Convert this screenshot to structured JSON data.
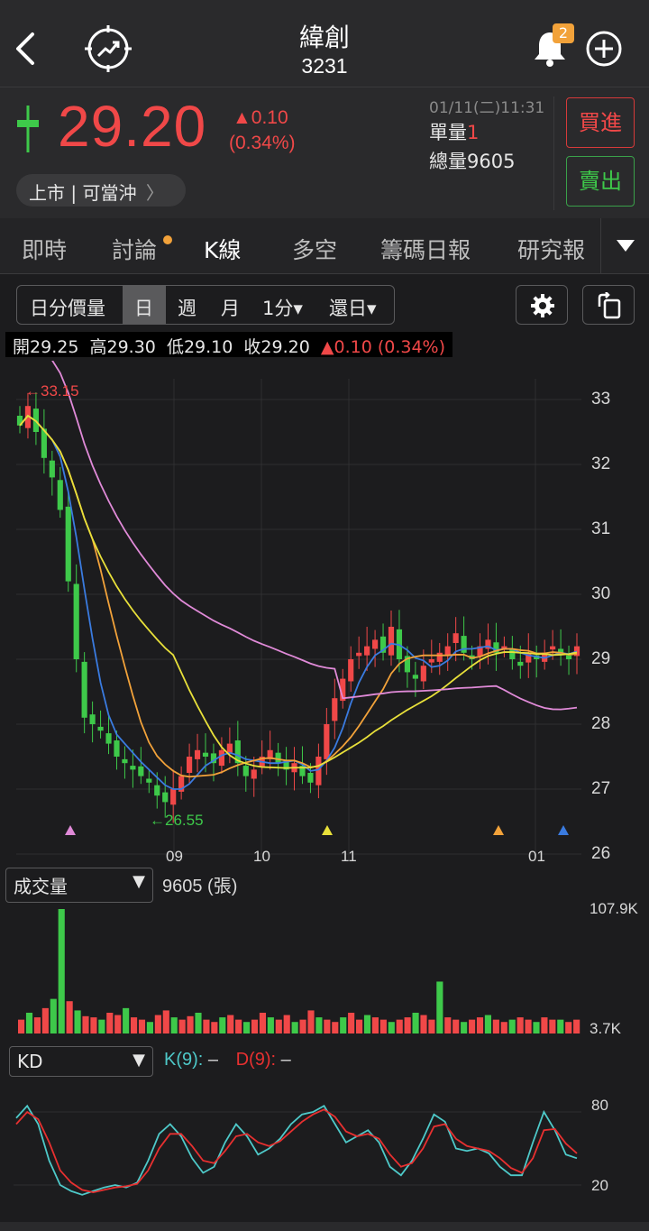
{
  "header": {
    "name": "緯創",
    "code": "3231",
    "notification_count": "2"
  },
  "quote": {
    "price": "29.20",
    "change": "▲0.10",
    "change_pct": "(0.34%)",
    "datetime": "01/11(二)11:31",
    "unit_label": "單量",
    "unit_value": "1",
    "total_label": "總量",
    "total_value": "9605",
    "market_pill": "上市 | 可當沖",
    "buy_label": "買進",
    "sell_label": "賣出"
  },
  "tabs": [
    "即時",
    "討論",
    "K線",
    "多空",
    "籌碼日報",
    "研究報"
  ],
  "active_tab": "K線",
  "toolbar": {
    "items": [
      "日分價量",
      "日",
      "週",
      "月",
      "1分▾",
      "還日▾"
    ],
    "active": "日"
  },
  "ohlc": {
    "open_label": "開",
    "open": "29.25",
    "high_label": "高",
    "high": "29.30",
    "low_label": "低",
    "low": "29.10",
    "close_label": "收",
    "close": "29.20",
    "change": "▲0.10 (0.34%)"
  },
  "price_chart": {
    "y_ticks": [
      "33",
      "32",
      "31",
      "30",
      "29",
      "28",
      "27",
      "26"
    ],
    "x_ticks": [
      "09",
      "10",
      "11",
      "01"
    ],
    "high_marker": "←33.15",
    "low_marker": "←26.55"
  },
  "volume_panel": {
    "selector": "成交量",
    "value": "9605 (張)",
    "y_ticks": [
      "107.9K",
      "3.7K"
    ]
  },
  "kd_panel": {
    "selector": "KD",
    "k_label": "K(9):",
    "k_value": "–",
    "d_label": "D(9):",
    "d_value": "–",
    "y_ticks": [
      "80",
      "20"
    ]
  },
  "colors": {
    "up": "#f04848",
    "down": "#3ec94a",
    "ma5": "#3a7be0",
    "ma10": "#f2a23a",
    "ma20": "#e8e03a",
    "ma60": "#e08ad8",
    "k_line": "#4ec9c9",
    "d_line": "#e83030"
  },
  "chart_data": {
    "type": "candlestick",
    "ylim": [
      26,
      33.3
    ],
    "close_series_approx": [
      32.6,
      32.9,
      32.5,
      32.1,
      31.8,
      31.3,
      30.2,
      29.0,
      28.1,
      28.0,
      27.9,
      27.7,
      27.5,
      27.4,
      27.3,
      27.2,
      27.1,
      26.9,
      26.8,
      27.0,
      27.2,
      27.5,
      27.6,
      27.5,
      27.4,
      27.6,
      27.7,
      27.4,
      27.2,
      27.3,
      27.5,
      27.6,
      27.4,
      27.3,
      27.4,
      27.2,
      27.1,
      27.5,
      28.0,
      28.4,
      28.7,
      29.0,
      29.1,
      29.2,
      29.3,
      29.1,
      29.5,
      29.0,
      28.8,
      28.7,
      28.9,
      29.0,
      29.1,
      29.2,
      29.4,
      29.1,
      29.0,
      29.2,
      29.3,
      29.1,
      29.2,
      29.0,
      28.9,
      29.1,
      29.0,
      29.1,
      29.2,
      29.1,
      29.0,
      29.2
    ],
    "volume_series_approx": [
      12,
      18,
      14,
      22,
      30,
      107.9,
      28,
      20,
      15,
      14,
      12,
      18,
      16,
      22,
      14,
      12,
      10,
      16,
      20,
      14,
      12,
      15,
      18,
      12,
      10,
      14,
      16,
      12,
      10,
      12,
      18,
      14,
      12,
      16,
      10,
      12,
      20,
      14,
      12,
      10,
      14,
      18,
      12,
      16,
      14,
      12,
      10,
      12,
      14,
      18,
      16,
      12,
      45,
      14,
      12,
      10,
      12,
      14,
      16,
      12,
      10,
      12,
      14,
      12,
      10,
      14,
      12,
      12,
      10,
      12
    ],
    "k_series_approx": [
      75,
      85,
      70,
      40,
      20,
      15,
      12,
      15,
      18,
      20,
      18,
      22,
      40,
      62,
      70,
      60,
      42,
      30,
      35,
      55,
      70,
      60,
      45,
      50,
      58,
      70,
      78,
      80,
      85,
      70,
      55,
      60,
      65,
      55,
      35,
      28,
      40,
      58,
      78,
      72,
      50,
      48,
      50,
      46,
      35,
      28,
      28,
      55,
      80,
      65,
      45,
      42
    ],
    "d_series_approx": [
      70,
      80,
      74,
      55,
      32,
      22,
      16,
      14,
      16,
      18,
      19,
      21,
      32,
      50,
      62,
      62,
      52,
      40,
      38,
      48,
      60,
      62,
      55,
      52,
      56,
      64,
      72,
      78,
      82,
      76,
      64,
      60,
      62,
      58,
      45,
      35,
      38,
      50,
      68,
      70,
      58,
      52,
      50,
      48,
      42,
      34,
      30,
      42,
      65,
      66,
      54,
      46
    ]
  }
}
